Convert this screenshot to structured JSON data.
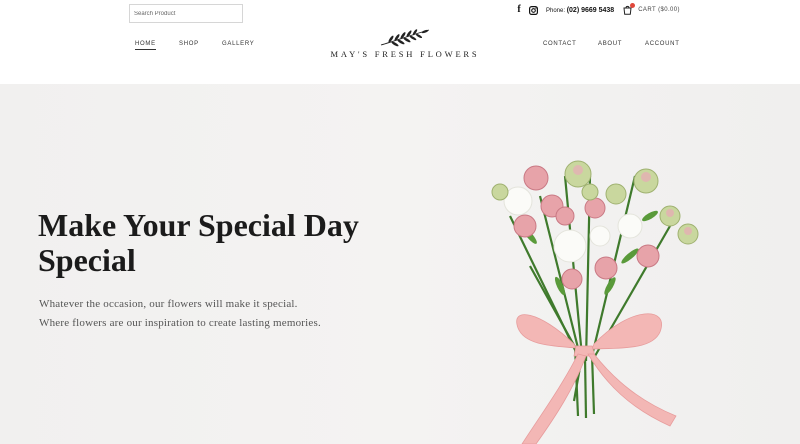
{
  "header": {
    "search": {
      "placeholder": "Search Product",
      "value": ""
    },
    "social": {
      "facebook_glyph": "f"
    },
    "phone": {
      "label": "Phone:",
      "number": "(02) 9669 5438"
    },
    "cart": {
      "label": "CART",
      "total": "($0.00)"
    },
    "nav_left": [
      {
        "label": "HOME",
        "active": true
      },
      {
        "label": "SHOP"
      },
      {
        "label": "GALLERY"
      }
    ],
    "nav_right": [
      {
        "label": "CONTACT"
      },
      {
        "label": "ABOUT"
      },
      {
        "label": "ACCOUNT"
      }
    ],
    "logo": {
      "text": "MAY'S FRESH FLOWERS",
      "icon": "sprig-icon"
    },
    "icons": [
      "facebook-icon",
      "instagram-icon",
      "cart-icon"
    ]
  },
  "hero": {
    "title": "Make Your Special Day Special",
    "lines": [
      "Whatever the occasion, our flowers will make it special.",
      "Where flowers are our inspiration to create lasting memories."
    ]
  },
  "colors": {
    "hero_background": "#f2f1f0",
    "text_dark": "#1b1b1b",
    "text_muted": "#555555",
    "cart_badge": "#e0473a",
    "ribbon": "#f3b7b5",
    "rose": "#e7a3a9",
    "leaf": "#3f7a2c"
  }
}
